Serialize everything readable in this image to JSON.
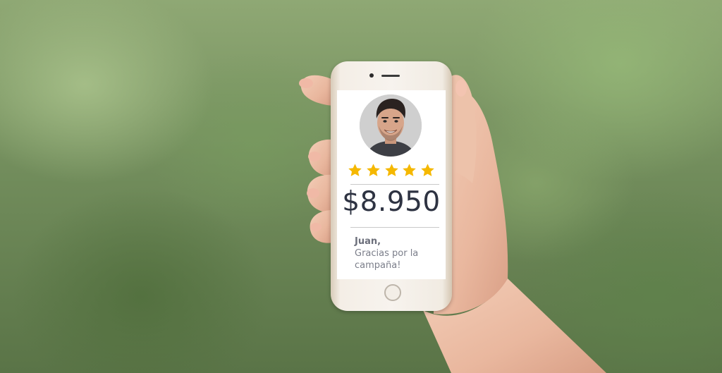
{
  "screen": {
    "price": "$8.950",
    "rating": 5,
    "rating_max": 5,
    "message_name": "Juan,",
    "message_lines": [
      "Gracias por la",
      "campaña!"
    ]
  },
  "colors": {
    "star": "#f5b800",
    "price": "#2e3342",
    "message": "#7b7e8a"
  }
}
